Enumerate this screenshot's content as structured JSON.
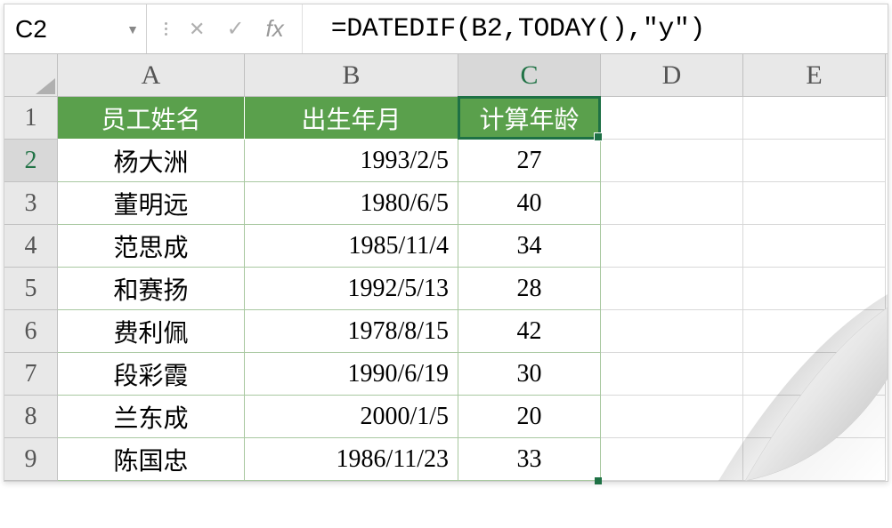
{
  "name_box": "C2",
  "formula": "=DATEDIF(B2,TODAY(),\"y\")",
  "columns": [
    "A",
    "B",
    "C",
    "D",
    "E"
  ],
  "active_column": "C",
  "active_row": "2",
  "headers": {
    "A": "员工姓名",
    "B": "出生年月",
    "C": "计算年龄"
  },
  "rows": [
    {
      "num": "1"
    },
    {
      "num": "2",
      "A": "杨大洲",
      "B": "1993/2/5",
      "C": "27"
    },
    {
      "num": "3",
      "A": "董明远",
      "B": "1980/6/5",
      "C": "40"
    },
    {
      "num": "4",
      "A": "范思成",
      "B": "1985/11/4",
      "C": "34"
    },
    {
      "num": "5",
      "A": "和赛扬",
      "B": "1992/5/13",
      "C": "28"
    },
    {
      "num": "6",
      "A": "费利佩",
      "B": "1978/8/15",
      "C": "42"
    },
    {
      "num": "7",
      "A": "段彩霞",
      "B": "1990/6/19",
      "C": "30"
    },
    {
      "num": "8",
      "A": "兰东成",
      "B": "2000/1/5",
      "C": "20"
    },
    {
      "num": "9",
      "A": "陈国忠",
      "B": "1986/11/23",
      "C": "33"
    }
  ],
  "fx_label": "fx",
  "cancel_glyph": "✕",
  "confirm_glyph": "✓"
}
